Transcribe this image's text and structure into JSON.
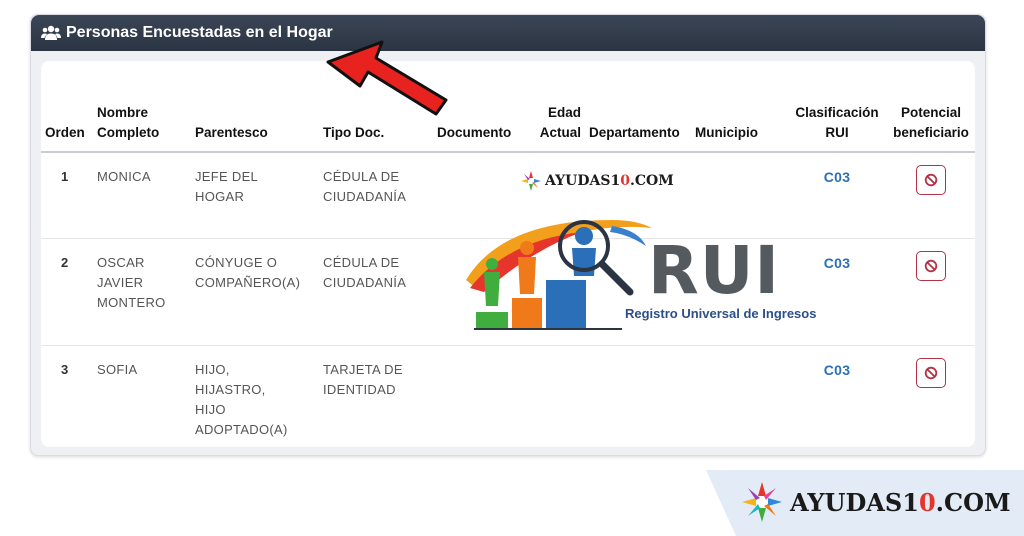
{
  "panel": {
    "title": "Personas Encuestadas en el Hogar",
    "icon": "users-icon"
  },
  "table": {
    "headers": {
      "orden": "Orden",
      "nombre_1": "Nombre",
      "nombre_2": "Completo",
      "parentesco": "Parentesco",
      "tipo_doc": "Tipo Doc.",
      "documento": "Documento",
      "edad_1": "Edad",
      "edad_2": "Actual",
      "departamento": "Departamento",
      "municipio": "Municipio",
      "clas_1": "Clasificación",
      "clas_2": "RUI",
      "pot_1": "Potencial",
      "pot_2": "beneficiario"
    },
    "rows": [
      {
        "orden": "1",
        "nombre": [
          "MONICA"
        ],
        "parentesco": [
          "JEFE DEL",
          "HOGAR"
        ],
        "tipo_doc": [
          "CÉDULA DE",
          "CIUDADANÍA"
        ],
        "clasificacion": "C03",
        "potencial_icon": "ban-icon"
      },
      {
        "orden": "2",
        "nombre": [
          "OSCAR",
          "JAVIER",
          "MONTERO"
        ],
        "parentesco": [
          "CÓNYUGE O",
          "COMPAÑERO(A)"
        ],
        "tipo_doc": [
          "CÉDULA DE",
          "CIUDADANÍA"
        ],
        "clasificacion": "C03",
        "potencial_icon": "ban-icon"
      },
      {
        "orden": "3",
        "nombre": [
          "SOFIA"
        ],
        "parentesco": [
          "HIJO,",
          "HIJASTRO,",
          "HIJO",
          "ADOPTADO(A)"
        ],
        "tipo_doc": [
          "TARJETA DE",
          "IDENTIDAD"
        ],
        "clasificacion": "C03",
        "potencial_icon": "ban-icon"
      }
    ]
  },
  "watermark": {
    "site_a": "AYUDAS1",
    "site_o": "0",
    "site_b": ".COM"
  },
  "rui_logo": {
    "title": "RUI",
    "subtitle": "Registro Universal de Ingresos"
  },
  "colors": {
    "header_bg": "#2f3846",
    "classification": "#2a6fb8",
    "ban_button": "#b43246",
    "arrow": "#e8231f"
  }
}
